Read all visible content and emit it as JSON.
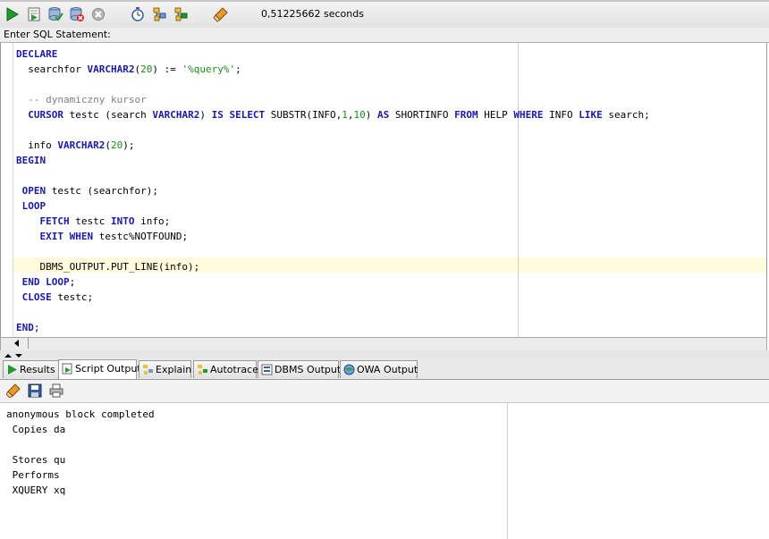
{
  "toolbar": {
    "buttons": [
      {
        "icon": "run-statement-icon"
      },
      {
        "icon": "run-script-icon"
      },
      {
        "icon": "commit-icon"
      },
      {
        "icon": "rollback-icon"
      },
      {
        "icon": "cancel-icon"
      },
      {
        "icon": "sql-history-icon"
      },
      {
        "icon": "explain-plan-icon"
      },
      {
        "icon": "autotrace-icon"
      },
      {
        "icon": "clear-icon"
      }
    ],
    "timing": "0,51225662 seconds"
  },
  "label": "Enter SQL Statement:",
  "editor": {
    "lines": [
      [
        {
          "t": "DECLARE",
          "c": "kw"
        }
      ],
      [
        {
          "t": "  searchfor ",
          "c": ""
        },
        {
          "t": "VARCHAR2",
          "c": "kw"
        },
        {
          "t": "(",
          "c": ""
        },
        {
          "t": "20",
          "c": "num"
        },
        {
          "t": ") := ",
          "c": ""
        },
        {
          "t": "'%query%'",
          "c": "str"
        },
        {
          "t": ";",
          "c": ""
        }
      ],
      [],
      [
        {
          "t": "  -- dynamiczny kursor",
          "c": "cmt"
        }
      ],
      [
        {
          "t": "  ",
          "c": ""
        },
        {
          "t": "CURSOR",
          "c": "kw"
        },
        {
          "t": " testc (search ",
          "c": ""
        },
        {
          "t": "VARCHAR2",
          "c": "kw"
        },
        {
          "t": ") ",
          "c": ""
        },
        {
          "t": "IS SELECT",
          "c": "kw"
        },
        {
          "t": " SUBSTR(INFO,",
          "c": ""
        },
        {
          "t": "1",
          "c": "num"
        },
        {
          "t": ",",
          "c": ""
        },
        {
          "t": "10",
          "c": "num"
        },
        {
          "t": ") ",
          "c": ""
        },
        {
          "t": "AS",
          "c": "kw"
        },
        {
          "t": " SHORTINFO ",
          "c": ""
        },
        {
          "t": "FROM",
          "c": "kw"
        },
        {
          "t": " HELP ",
          "c": ""
        },
        {
          "t": "WHERE",
          "c": "kw"
        },
        {
          "t": " INFO ",
          "c": ""
        },
        {
          "t": "LIKE",
          "c": "kw"
        },
        {
          "t": " search;",
          "c": ""
        }
      ],
      [],
      [
        {
          "t": "  info ",
          "c": ""
        },
        {
          "t": "VARCHAR2",
          "c": "kw"
        },
        {
          "t": "(",
          "c": ""
        },
        {
          "t": "20",
          "c": "num"
        },
        {
          "t": ");",
          "c": ""
        }
      ],
      [
        {
          "t": "BEGIN",
          "c": "kw"
        }
      ],
      [],
      [
        {
          "t": " ",
          "c": ""
        },
        {
          "t": "OPEN",
          "c": "kw"
        },
        {
          "t": " testc (searchfor);",
          "c": ""
        }
      ],
      [
        {
          "t": " ",
          "c": ""
        },
        {
          "t": "LOOP",
          "c": "kw"
        }
      ],
      [
        {
          "t": "    ",
          "c": ""
        },
        {
          "t": "FETCH",
          "c": "kw"
        },
        {
          "t": " testc ",
          "c": ""
        },
        {
          "t": "INTO",
          "c": "kw"
        },
        {
          "t": " info;",
          "c": ""
        }
      ],
      [
        {
          "t": "    ",
          "c": ""
        },
        {
          "t": "EXIT WHEN",
          "c": "kw"
        },
        {
          "t": " testc%NOTFOUND;",
          "c": ""
        }
      ],
      [],
      [
        {
          "t": "    DBMS_OUTPUT.PUT_LINE(info);",
          "c": ""
        }
      ],
      [
        {
          "t": " ",
          "c": ""
        },
        {
          "t": "END LOOP",
          "c": "kw"
        },
        {
          "t": ";",
          "c": ""
        }
      ],
      [
        {
          "t": " ",
          "c": ""
        },
        {
          "t": "CLOSE",
          "c": "kw"
        },
        {
          "t": " testc;",
          "c": ""
        }
      ],
      [],
      [
        {
          "t": "END",
          "c": "kw"
        },
        {
          "t": ";",
          "c": ""
        }
      ]
    ]
  },
  "tabs": [
    {
      "label": "Results",
      "icon": "run-icon",
      "active": false
    },
    {
      "label": "Script Output",
      "icon": "script-output-icon",
      "active": true
    },
    {
      "label": "Explain",
      "icon": "explain-icon",
      "active": false
    },
    {
      "label": "Autotrace",
      "icon": "autotrace-icon",
      "active": false
    },
    {
      "label": "DBMS Output",
      "icon": "dbms-output-icon",
      "active": false
    },
    {
      "label": "OWA Output",
      "icon": "owa-output-icon",
      "active": false
    }
  ],
  "output_toolbar": [
    {
      "icon": "clear-icon"
    },
    {
      "icon": "save-icon"
    },
    {
      "icon": "print-icon"
    }
  ],
  "output": {
    "lines": [
      "anonymous block completed",
      " Copies da",
      "",
      " Stores qu",
      " Performs",
      " XQUERY xq"
    ]
  },
  "colors": {
    "keyword": "#1a1aa6",
    "number": "#1a8a1a",
    "comment": "#808080",
    "current_line": "#fffbdd"
  }
}
